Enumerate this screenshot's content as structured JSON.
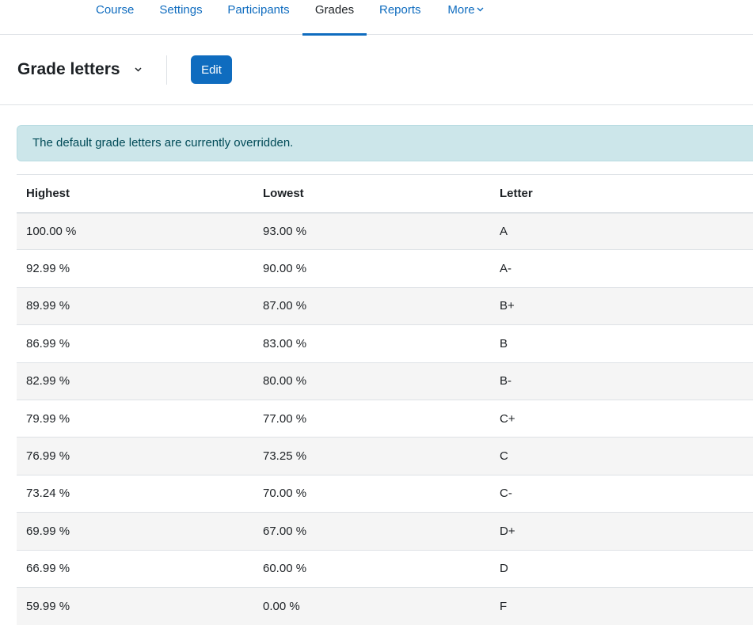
{
  "nav": {
    "tabs": [
      {
        "label": "Course",
        "active": false
      },
      {
        "label": "Settings",
        "active": false
      },
      {
        "label": "Participants",
        "active": false
      },
      {
        "label": "Grades",
        "active": true
      },
      {
        "label": "Reports",
        "active": false
      },
      {
        "label": "More",
        "active": false,
        "dropdown": true
      }
    ]
  },
  "header": {
    "title": "Grade letters",
    "title_icon": "chevron-down-icon",
    "edit_label": "Edit"
  },
  "alert": {
    "message": "The default grade letters are currently overridden."
  },
  "table": {
    "columns": [
      "Highest",
      "Lowest",
      "Letter"
    ],
    "rows": [
      {
        "highest": "100.00 %",
        "lowest": "93.00 %",
        "letter": "A"
      },
      {
        "highest": "92.99 %",
        "lowest": "90.00 %",
        "letter": "A-"
      },
      {
        "highest": "89.99 %",
        "lowest": "87.00 %",
        "letter": "B+"
      },
      {
        "highest": "86.99 %",
        "lowest": "83.00 %",
        "letter": "B"
      },
      {
        "highest": "82.99 %",
        "lowest": "80.00 %",
        "letter": "B-"
      },
      {
        "highest": "79.99 %",
        "lowest": "77.00 %",
        "letter": "C+"
      },
      {
        "highest": "76.99 %",
        "lowest": "73.25 %",
        "letter": "C"
      },
      {
        "highest": "73.24 %",
        "lowest": "70.00 %",
        "letter": "C-"
      },
      {
        "highest": "69.99 %",
        "lowest": "67.00 %",
        "letter": "D+"
      },
      {
        "highest": "66.99 %",
        "lowest": "60.00 %",
        "letter": "D"
      },
      {
        "highest": "59.99 %",
        "lowest": "0.00 %",
        "letter": "F"
      }
    ]
  },
  "colors": {
    "primary": "#0f6cbf",
    "alert_bg": "#cce6ea",
    "alert_text": "#004a57",
    "stripe": "#f5f5f5"
  }
}
